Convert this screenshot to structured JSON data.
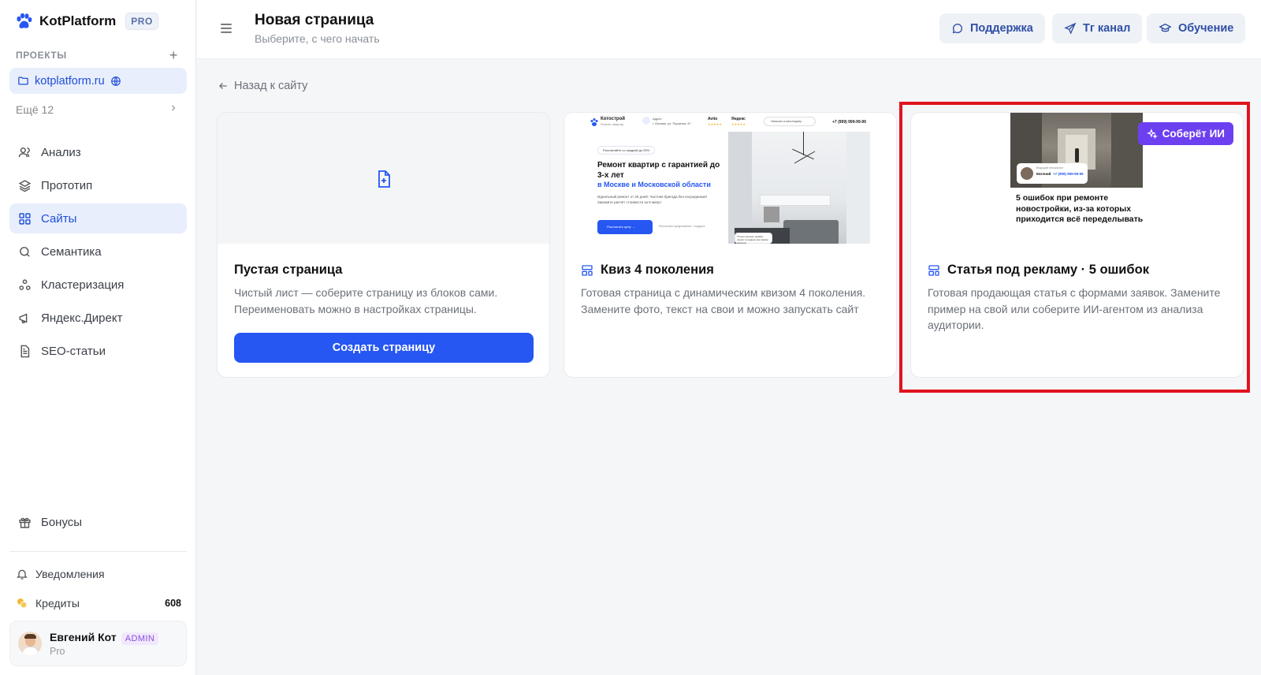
{
  "brand": {
    "name": "KotPlatform",
    "badge": "PRO"
  },
  "sidebar": {
    "projects_label": "ПРОЕКТЫ",
    "current_project": "kotplatform.ru",
    "more_label": "Ещё 12",
    "nav": [
      {
        "label": "Анализ",
        "icon": "users-icon"
      },
      {
        "label": "Прототип",
        "icon": "layers-icon"
      },
      {
        "label": "Сайты",
        "icon": "grid-icon",
        "active": true
      },
      {
        "label": "Семантика",
        "icon": "search-icon"
      },
      {
        "label": "Кластеризация",
        "icon": "cluster-icon"
      },
      {
        "label": "Яндекс.Директ",
        "icon": "megaphone-icon"
      },
      {
        "label": "SEO-статьи",
        "icon": "document-icon"
      }
    ],
    "bonus_label": "Бонусы",
    "notifications_label": "Уведомления",
    "credits_label": "Кредиты",
    "credits_value": "608",
    "user": {
      "name": "Евгений Кот",
      "role": "ADMIN",
      "plan": "Pro"
    }
  },
  "header": {
    "title": "Новая страница",
    "subtitle": "Выберите, с чего начать",
    "buttons": {
      "support": "Поддержка",
      "tg": "Тг канал",
      "learn": "Обучение"
    }
  },
  "main": {
    "back_label": "Назад к сайту",
    "cards": [
      {
        "title": "Пустая страница",
        "desc": "Чистый лист — соберите страницу из блоков сами. Переименовать можно в настройках страницы.",
        "button": "Создать страницу"
      },
      {
        "title": "Квиз 4 поколения",
        "desc": "Готовая страница с динамическим квизом 4 поколения. Замените фото, текст на свои и можно запускать сайт",
        "preview": {
          "company": "Котострой",
          "company_sub": "Ремонт квартир",
          "address": "Адрес\nг. Москва, ул. Пушкина, 47",
          "avito": "Avito",
          "yandex": "Яндекс",
          "messenger": "Написать в мессенджер",
          "phone": "+7 (999) 999-99-99",
          "discount": "Рассчитайте со скидкой до 25%",
          "headline": "Ремонт квартир с гарантией до 3-х лет",
          "headline_accent": "в Москве и Московской области",
          "body": "Идеальный ремонт от 30 дней. Частная бригада без посредников! Закажите расчёт стоимости за 5 минут",
          "cta": "Рассчитать цену →",
          "note": "Рассчитать предложение + подарок",
          "chat": "Только сегодня: дизайн-проект в подарок при заказе ремонта"
        }
      },
      {
        "title": "Статья под рекламу · 5 ошибок",
        "desc": "Готовая продающая статья с формами заявок. Замените пример на свой или соберите ИИ-агентом из анализа аудитории.",
        "badge": "Соберёт ИИ",
        "preview": {
          "specialist": "Ведущий специалист",
          "name": "Евгений",
          "phone": "+7 (999) 999-99-99",
          "headline": "5 ошибок при ремонте новостройки, из-за которых приходится всё переделывать"
        }
      }
    ]
  },
  "colors": {
    "accent": "#2657f2",
    "ai": "#6c3ff0",
    "highlight": "#e0141e"
  }
}
